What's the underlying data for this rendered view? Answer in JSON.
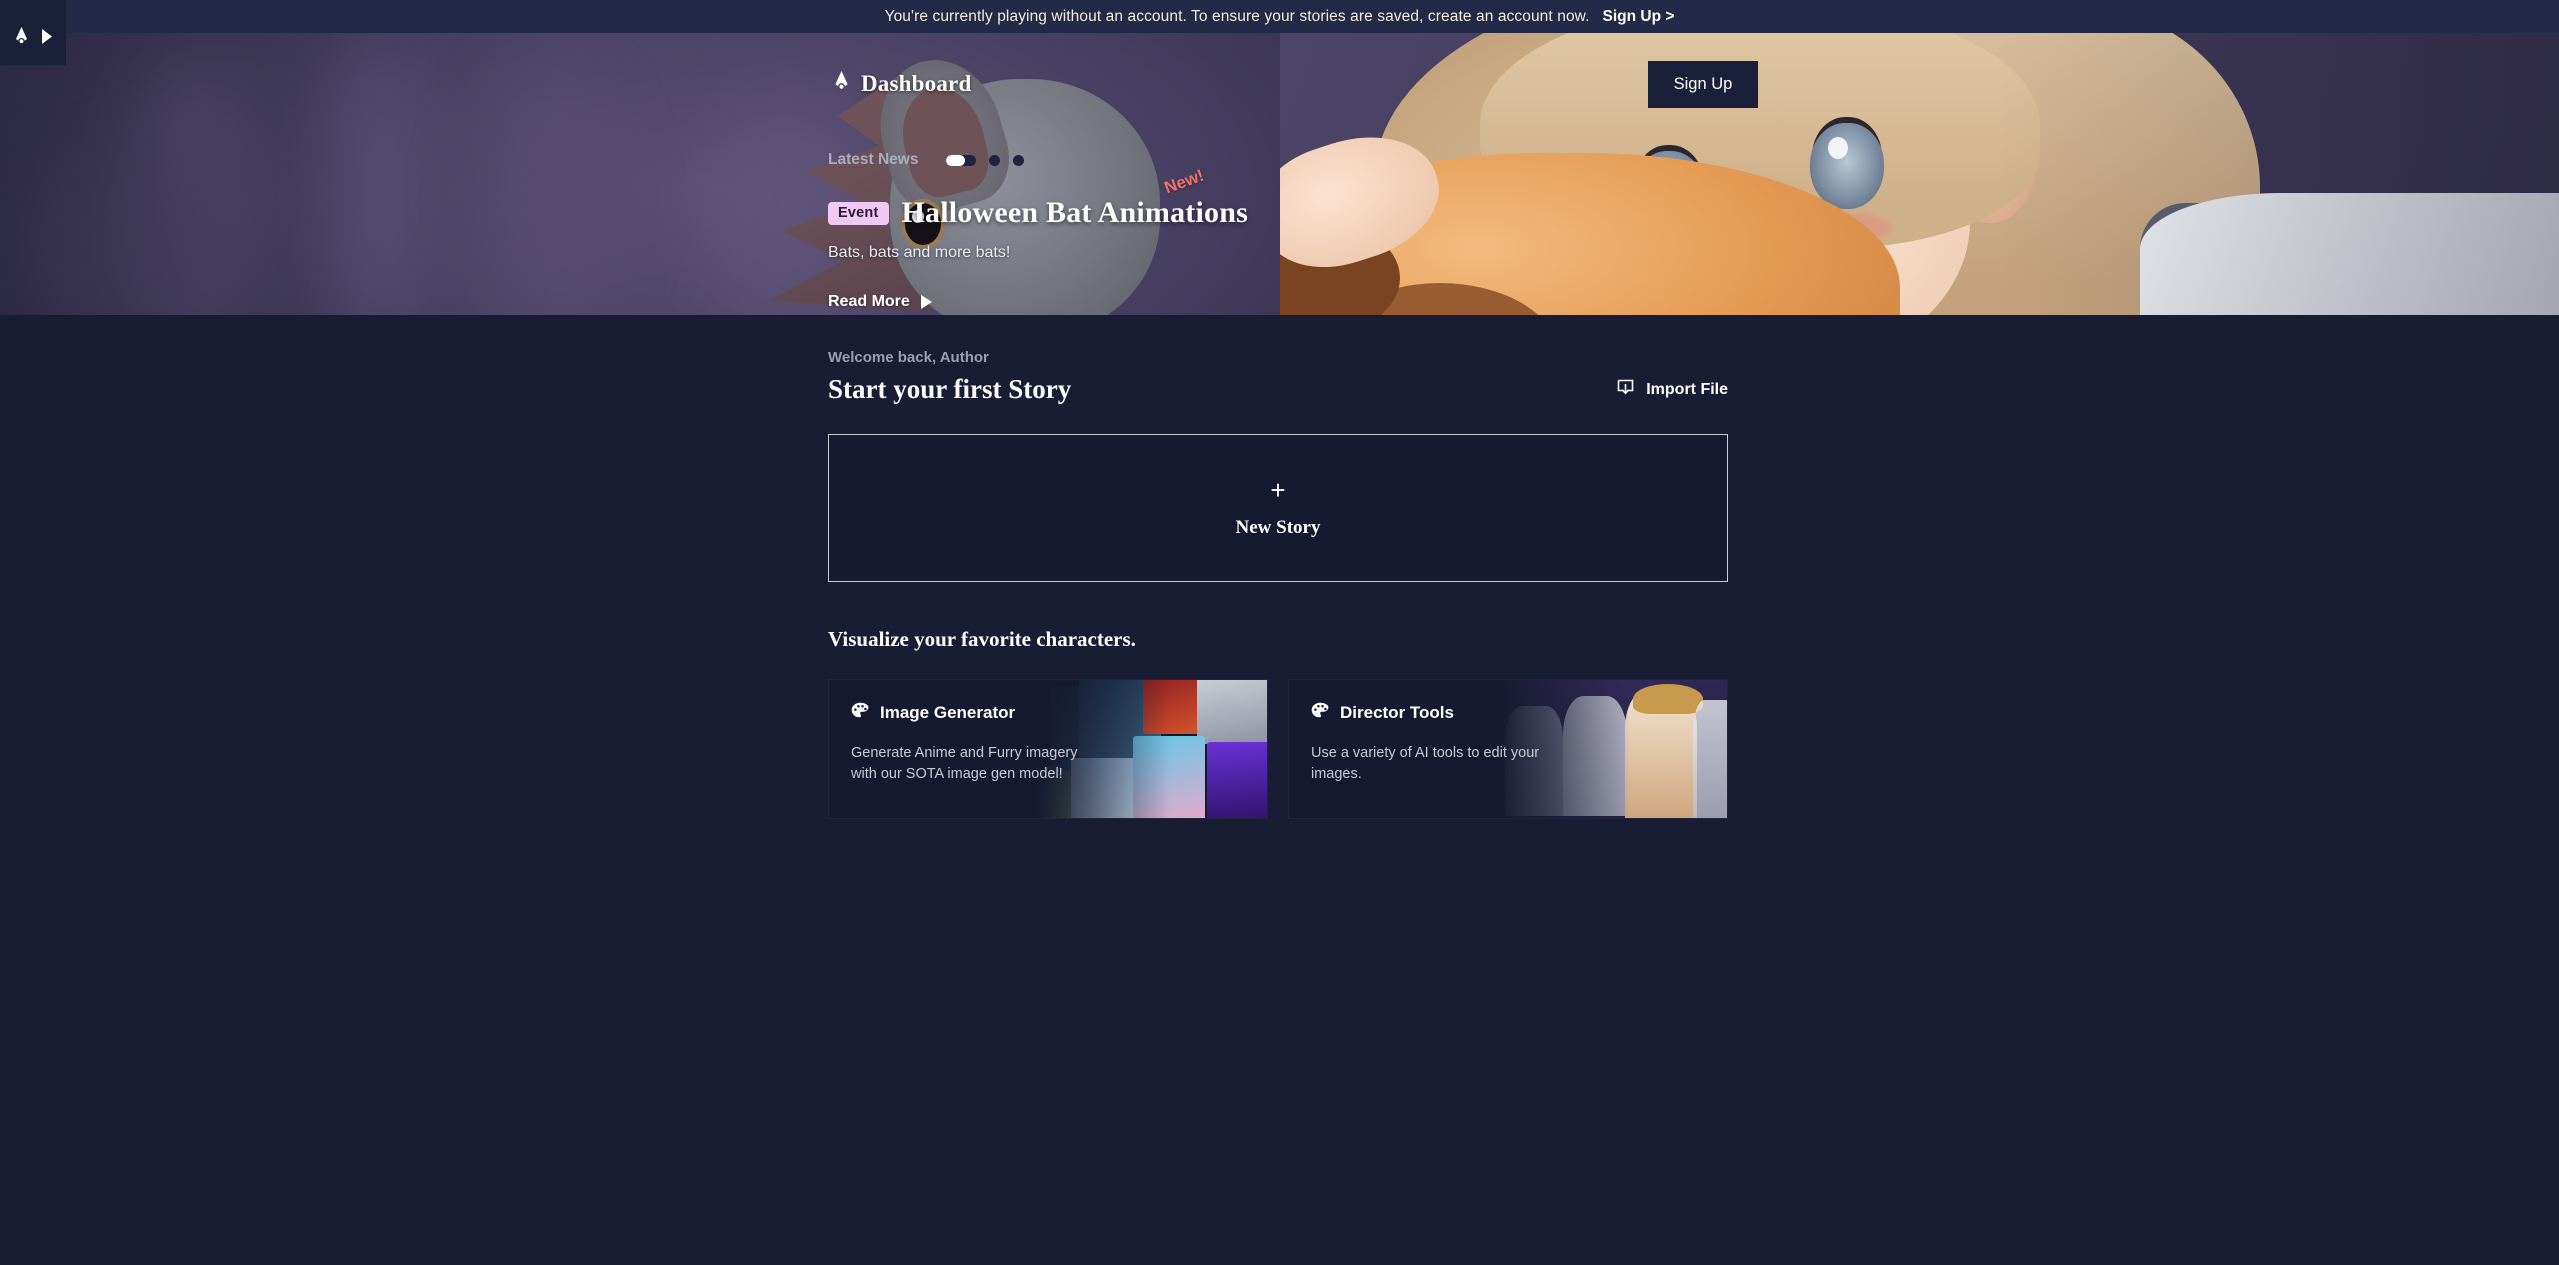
{
  "banner": {
    "message": "You're currently playing without an account. To ensure your stories are saved, create an account now.",
    "link_label": "Sign Up >"
  },
  "corner": {
    "logo_icon": "novelai-pen-nib-icon",
    "expand_icon": "expand-sidebar-triangle-icon"
  },
  "header": {
    "logo_icon": "novelai-pen-nib-icon",
    "title": "Dashboard",
    "signup_label": "Sign Up"
  },
  "news": {
    "section_label": "Latest News",
    "carousel": {
      "active_index": 0,
      "count": 3,
      "progress_percent": 62
    },
    "badge": "Event",
    "title": "Halloween Bat Animations",
    "flag": "New!",
    "description": "Bats, bats and more bats!",
    "read_more_label": "Read More",
    "read_more_icon": "triangle-right-icon"
  },
  "main": {
    "welcome": "Welcome back, Author",
    "start_title": "Start your first Story",
    "import": {
      "icon": "import-file-icon",
      "label": "Import File"
    },
    "new_story": {
      "plus": "+",
      "label": "New Story"
    },
    "visualize_title": "Visualize your favorite characters.",
    "tools": [
      {
        "icon": "palette-icon",
        "name": "Image Generator",
        "description": "Generate Anime and Furry imagery with our SOTA image gen model!"
      },
      {
        "icon": "palette-icon",
        "name": "Director Tools",
        "description": "Use a variety of AI tools to edit your images."
      }
    ]
  },
  "colors": {
    "banner_bg": "#232a48",
    "page_bg": "#191d34",
    "card_bg": "#161a30",
    "accent_badge": "#efc9f3",
    "new_flag": "#f0736b",
    "text_primary": "#ffffff",
    "text_muted": "#9b9fb4"
  }
}
